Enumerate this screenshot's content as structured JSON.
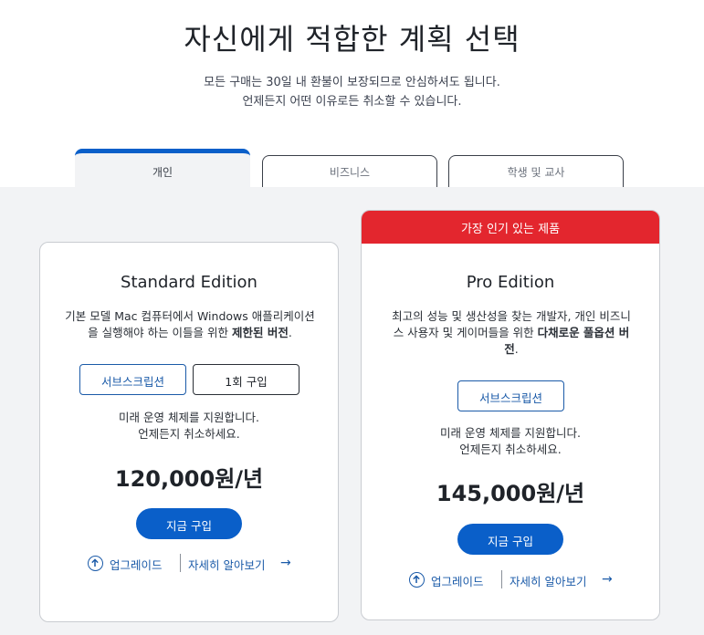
{
  "header": {
    "title": "자신에게 적합한 계획 선택",
    "subtitle_line1": "모든 구매는 30일 내 환불이 보장되므로 안심하셔도 됩니다.",
    "subtitle_line2": "언제든지 어떤 이유로든 취소할 수 있습니다."
  },
  "tabs": [
    {
      "label": "개인",
      "active": true
    },
    {
      "label": "비즈니스",
      "active": false
    },
    {
      "label": "학생 및 교사",
      "active": false
    }
  ],
  "standard": {
    "name": "Standard Edition",
    "desc_line1": "기본 모델 Mac 컴퓨터에서 Windows 애플리케이션",
    "desc_line2_prefix": "을 실행해야 하는 이들을 위한 ",
    "desc_line2_bold": "제한된 버전",
    "desc_line2_suffix": ".",
    "option_subscription": "서브스크립션",
    "option_once": "1회 구입",
    "note_line1": "미래 운영 체제를 지원합니다.",
    "note_line2": "언제든지 취소하세요.",
    "price": "120,000원/년",
    "buy": "지금 구입",
    "upgrade": "업그레이드",
    "learn_more": "자세히 알아보기"
  },
  "pro": {
    "badge": "가장 인기 있는 제품",
    "name": "Pro Edition",
    "desc_line1": "최고의 성능 및 생산성을 찾는 개발자, 개인 비즈니",
    "desc_line2_prefix": "스 사용자 및 게이머들을 위한 ",
    "desc_line2_bold": "다채로운 풀옵션 버",
    "desc_line3_bold": "전",
    "desc_line3_suffix": ".",
    "option_subscription": "서브스크립션",
    "note_line1": "미래 운영 체제를 지원합니다.",
    "note_line2": "언제든지 취소하세요.",
    "price": "145,000원/년",
    "buy": "지금 구입",
    "upgrade": "업그레이드",
    "learn_more": "자세히 알아보기"
  },
  "colors": {
    "accent": "#0a5fc9",
    "badge": "#e3262e",
    "band": "#f2f3f5"
  },
  "icons": {
    "upgrade": "arrow-up-circle-icon",
    "learn_more": "arrow-right-icon"
  }
}
